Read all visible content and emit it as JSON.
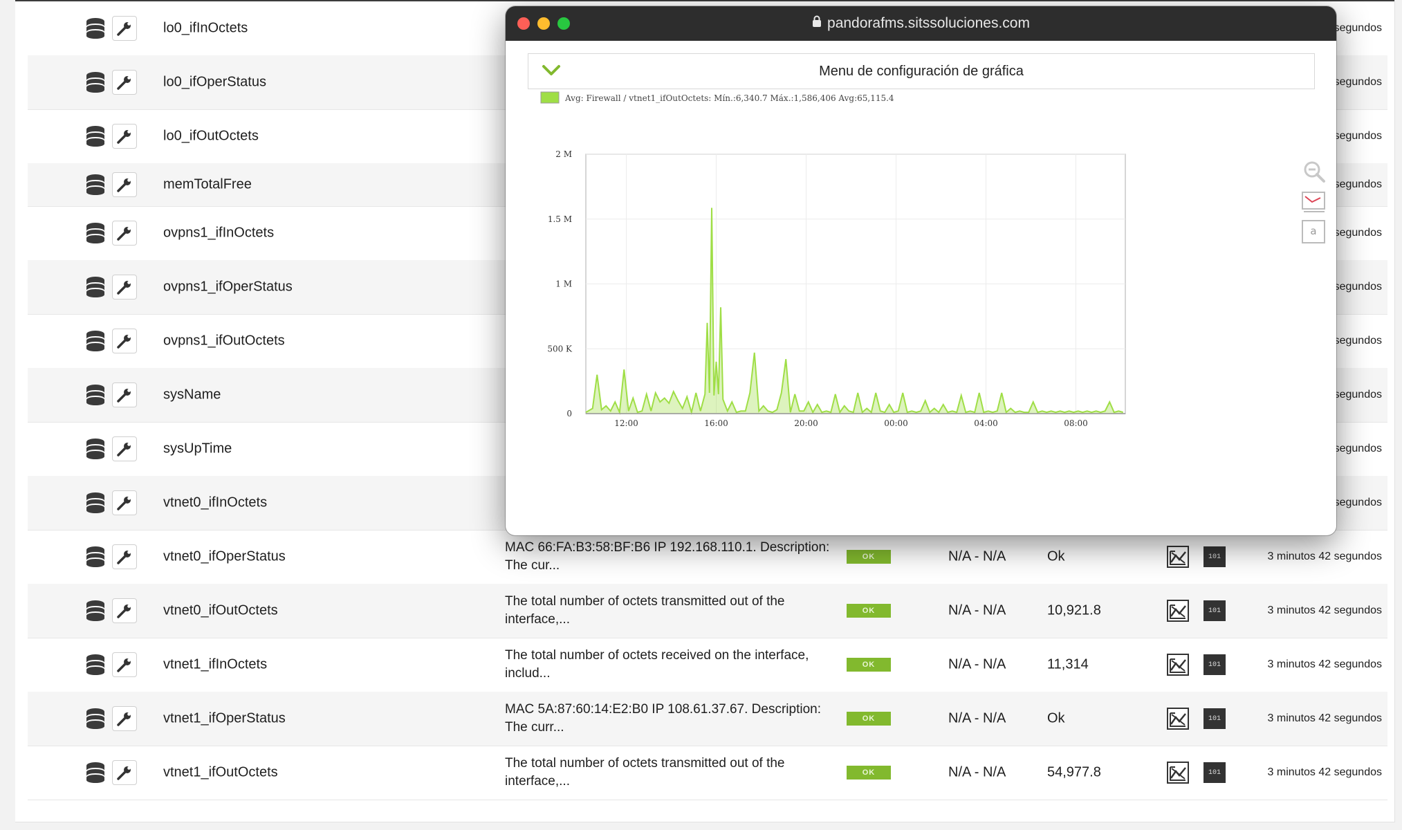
{
  "table": {
    "rows": [
      {
        "name": "lo0_ifInOctets",
        "desc": "",
        "status": "",
        "warncrit": "",
        "value": "",
        "time": "segundos"
      },
      {
        "name": "lo0_ifOperStatus",
        "desc": "",
        "status": "",
        "warncrit": "",
        "value": "",
        "time": "segundos"
      },
      {
        "name": "lo0_ifOutOctets",
        "desc": "",
        "status": "",
        "warncrit": "",
        "value": "",
        "time": "segundos"
      },
      {
        "name": "memTotalFree",
        "desc": "",
        "status": "",
        "warncrit": "",
        "value": "",
        "time": "segundos"
      },
      {
        "name": "ovpns1_ifInOctets",
        "desc": "",
        "status": "",
        "warncrit": "",
        "value": "",
        "time": "segundos"
      },
      {
        "name": "ovpns1_ifOperStatus",
        "desc": "",
        "status": "",
        "warncrit": "",
        "value": "",
        "time": "segundos"
      },
      {
        "name": "ovpns1_ifOutOctets",
        "desc": "",
        "status": "",
        "warncrit": "",
        "value": "",
        "time": "segundos"
      },
      {
        "name": "sysName",
        "desc": "",
        "status": "",
        "warncrit": "",
        "value": "",
        "time": "segundos"
      },
      {
        "name": "sysUpTime",
        "desc": "",
        "status": "",
        "warncrit": "",
        "value": "",
        "time": "segundos"
      },
      {
        "name": "vtnet0_ifInOctets",
        "desc": "",
        "status": "",
        "warncrit": "",
        "value": "",
        "time": "segundos"
      },
      {
        "name": "vtnet0_ifOperStatus",
        "desc": "MAC 66:FA:B3:58:BF:B6 IP 192.168.110.1. Description: The cur...",
        "status": "OK",
        "warncrit": "N/A - N/A",
        "value": "Ok",
        "time": "3 minutos 42 segundos"
      },
      {
        "name": "vtnet0_ifOutOctets",
        "desc": "The total number of octets transmitted out of the interface,...",
        "status": "OK",
        "warncrit": "N/A - N/A",
        "value": "10,921.8",
        "time": "3 minutos 42 segundos"
      },
      {
        "name": "vtnet1_ifInOctets",
        "desc": "The total number of octets received on the interface, includ...",
        "status": "OK",
        "warncrit": "N/A - N/A",
        "value": "11,314",
        "time": "3 minutos 42 segundos"
      },
      {
        "name": "vtnet1_ifOperStatus",
        "desc": "MAC 5A:87:60:14:E2:B0 IP 108.61.37.67. Description: The curr...",
        "status": "OK",
        "warncrit": "N/A - N/A",
        "value": "Ok",
        "time": "3 minutos 42 segundos"
      },
      {
        "name": "vtnet1_ifOutOctets",
        "desc": "The total number of octets transmitted out of the interface,...",
        "status": "OK",
        "warncrit": "N/A - N/A",
        "value": "54,977.8",
        "time": "3 minutos 42 segundos"
      }
    ],
    "raw_label": "101"
  },
  "window": {
    "url": "pandorafms.sitssoluciones.com",
    "config_title": "Menu de configuración de gráfica"
  },
  "chart_data": {
    "type": "area",
    "legend": "Avg: Firewall / vtnet1_ifOutOctets: Mín.:6,340.7 Máx.:1,586,406 Avg:65,115.4",
    "color": "#9fde46",
    "ylim": [
      0,
      2000000
    ],
    "yticks": [
      0,
      500000,
      1000000,
      1500000,
      2000000
    ],
    "ytick_labels": [
      "0",
      "500 K",
      "1 M",
      "1.5 M",
      "2 M"
    ],
    "xlim": [
      10.2,
      34.2
    ],
    "xticks": [
      12,
      16,
      20,
      24,
      28,
      32
    ],
    "xtick_labels": [
      "12:00",
      "16:00",
      "20:00",
      "00:00",
      "04:00",
      "08:00"
    ],
    "x": [
      10.2,
      10.5,
      10.7,
      10.9,
      11.1,
      11.3,
      11.5,
      11.7,
      11.9,
      12.1,
      12.3,
      12.5,
      12.7,
      12.9,
      13.1,
      13.3,
      13.5,
      13.7,
      13.9,
      14.1,
      14.3,
      14.5,
      14.7,
      14.9,
      15.1,
      15.3,
      15.5,
      15.6,
      15.7,
      15.8,
      15.9,
      16.0,
      16.1,
      16.2,
      16.3,
      16.5,
      16.7,
      16.9,
      17.1,
      17.3,
      17.5,
      17.7,
      17.9,
      18.1,
      18.3,
      18.5,
      18.7,
      18.9,
      19.1,
      19.3,
      19.5,
      19.7,
      19.9,
      20.1,
      20.3,
      20.5,
      20.7,
      20.9,
      21.1,
      21.3,
      21.5,
      21.7,
      21.9,
      22.1,
      22.3,
      22.5,
      22.7,
      22.9,
      23.1,
      23.3,
      23.5,
      23.7,
      23.9,
      24.1,
      24.3,
      24.5,
      24.7,
      24.9,
      25.1,
      25.3,
      25.5,
      25.7,
      25.9,
      26.1,
      26.3,
      26.5,
      26.7,
      26.9,
      27.1,
      27.3,
      27.5,
      27.7,
      27.9,
      28.1,
      28.3,
      28.5,
      28.7,
      28.9,
      29.1,
      29.3,
      29.5,
      29.7,
      29.9,
      30.1,
      30.3,
      30.5,
      30.7,
      30.9,
      31.1,
      31.3,
      31.5,
      31.7,
      31.9,
      32.1,
      32.3,
      32.5,
      32.7,
      32.9,
      33.1,
      33.3,
      33.5,
      33.7,
      33.9,
      34.1
    ],
    "y": [
      10000,
      40000,
      300000,
      30000,
      60000,
      20000,
      90000,
      10000,
      340000,
      20000,
      120000,
      10000,
      20000,
      150000,
      20000,
      160000,
      90000,
      120000,
      80000,
      170000,
      100000,
      40000,
      130000,
      10000,
      160000,
      20000,
      150000,
      700000,
      160000,
      1586406,
      140000,
      400000,
      150000,
      820000,
      110000,
      20000,
      90000,
      10000,
      20000,
      20000,
      160000,
      470000,
      20000,
      60000,
      20000,
      10000,
      30000,
      160000,
      420000,
      10000,
      150000,
      20000,
      20000,
      90000,
      10000,
      70000,
      10000,
      20000,
      10000,
      150000,
      10000,
      60000,
      20000,
      10000,
      160000,
      10000,
      40000,
      10000,
      160000,
      20000,
      10000,
      70000,
      10000,
      20000,
      160000,
      10000,
      20000,
      10000,
      20000,
      100000,
      10000,
      40000,
      10000,
      70000,
      10000,
      20000,
      10000,
      140000,
      10000,
      20000,
      10000,
      160000,
      10000,
      20000,
      10000,
      20000,
      160000,
      10000,
      40000,
      10000,
      20000,
      10000,
      10000,
      90000,
      10000,
      20000,
      10000,
      20000,
      10000,
      20000,
      10000,
      20000,
      10000,
      20000,
      10000,
      20000,
      10000,
      20000,
      10000,
      20000,
      90000,
      10000,
      20000,
      10000
    ]
  }
}
